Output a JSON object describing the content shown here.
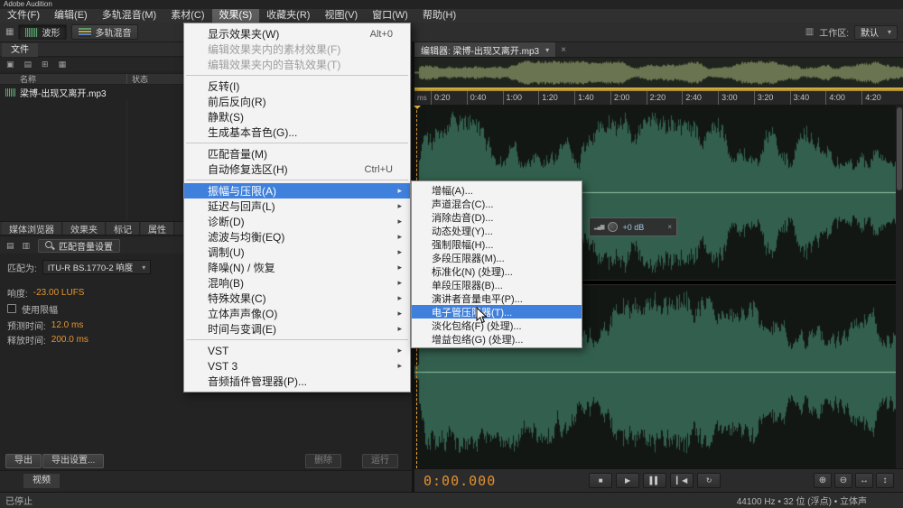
{
  "app": {
    "title": "Adobe Audition"
  },
  "menubar": [
    {
      "label": "文件(F)",
      "name": "menu-file"
    },
    {
      "label": "编辑(E)",
      "name": "menu-edit"
    },
    {
      "label": "多轨混音(M)",
      "name": "menu-multitrack"
    },
    {
      "label": "素材(C)",
      "name": "menu-clip"
    },
    {
      "label": "效果(S)",
      "name": "menu-effects",
      "active": true
    },
    {
      "label": "收藏夹(R)",
      "name": "menu-favorites"
    },
    {
      "label": "视图(V)",
      "name": "menu-view"
    },
    {
      "label": "窗口(W)",
      "name": "menu-window"
    },
    {
      "label": "帮助(H)",
      "name": "menu-help"
    }
  ],
  "toolbar": {
    "waveform_btn": "波形",
    "multitrack_btn": "多轨混音",
    "workspace_label": "工作区:",
    "workspace_value": "默认"
  },
  "files_panel": {
    "tab": "文件",
    "name_col": "名称",
    "status_col": "状态",
    "file_name": "梁博-出现又离开.mp3"
  },
  "effects_menu": {
    "items": [
      {
        "label": "显示效果夹(W)",
        "shortcut": "Alt+0"
      },
      {
        "label": "编辑效果夹内的素材效果(F)",
        "disabled": true
      },
      {
        "label": "编辑效果夹内的音轨效果(T)",
        "disabled": true
      },
      {
        "sep": true
      },
      {
        "label": "反转(I)"
      },
      {
        "label": "前后反向(R)"
      },
      {
        "label": "静默(S)"
      },
      {
        "label": "生成基本音色(G)..."
      },
      {
        "sep": true
      },
      {
        "label": "匹配音量(M)"
      },
      {
        "label": "自动修复选区(H)",
        "shortcut": "Ctrl+U"
      },
      {
        "sep": true
      },
      {
        "label": "振幅与压限(A)",
        "sub": true,
        "hl": true
      },
      {
        "label": "延迟与回声(L)",
        "sub": true
      },
      {
        "label": "诊断(D)",
        "sub": true
      },
      {
        "label": "滤波与均衡(EQ)",
        "sub": true
      },
      {
        "label": "调制(U)",
        "sub": true
      },
      {
        "label": "降噪(N) / 恢复",
        "sub": true
      },
      {
        "label": "混响(B)",
        "sub": true
      },
      {
        "label": "特殊效果(C)",
        "sub": true
      },
      {
        "label": "立体声声像(O)",
        "sub": true
      },
      {
        "label": "时间与变调(E)",
        "sub": true
      },
      {
        "sep": true
      },
      {
        "label": "VST",
        "sub": true
      },
      {
        "label": "VST 3",
        "sub": true
      },
      {
        "label": "音频插件管理器(P)..."
      }
    ]
  },
  "amplitude_submenu": {
    "items": [
      {
        "label": "增幅(A)..."
      },
      {
        "label": "声道混合(C)..."
      },
      {
        "label": "消除齿音(D)..."
      },
      {
        "label": "动态处理(Y)..."
      },
      {
        "label": "强制限幅(H)..."
      },
      {
        "label": "多段压限器(M)..."
      },
      {
        "label": "标准化(N) (处理)..."
      },
      {
        "label": "单段压限器(B)..."
      },
      {
        "label": "演讲者音量电平(P)..."
      },
      {
        "label": "电子管压限器(T)...",
        "hl": true
      },
      {
        "label": "淡化包络(F) (处理)..."
      },
      {
        "label": "增益包络(G) (处理)..."
      }
    ]
  },
  "left_tabs": [
    {
      "label": "媒体浏览器",
      "name": "tab-media-browser"
    },
    {
      "label": "效果夹",
      "name": "tab-effects-rack"
    },
    {
      "label": "标记",
      "name": "tab-markers"
    },
    {
      "label": "属性",
      "name": "tab-properties"
    }
  ],
  "match_volume": {
    "settings_btn": "匹配音量设置",
    "match_to_label": "匹配为:",
    "match_to_value": "ITU-R BS.1770-2 响度",
    "loudness_label": "响度:",
    "loudness_value": "-23.00 LUFS",
    "limiter_label": "使用限幅",
    "lookahead_label": "预测时间:",
    "lookahead_value": "12.0 ms",
    "release_label": "释放时间:",
    "release_value": "200.0 ms",
    "export_btn": "导出",
    "export_settings_btn": "导出设置...",
    "delete_btn": "删除",
    "run_btn": "运行"
  },
  "video_panel": {
    "tab": "视频"
  },
  "editor": {
    "tab": "编辑器: 梁博-出现又离开.mp3",
    "ruler_unit": "ms",
    "ruler_labels": [
      "0:20",
      "0:40",
      "1:00",
      "1:20",
      "1:40",
      "2:00",
      "2:20",
      "2:40",
      "3:00",
      "3:20",
      "3:40",
      "4:00",
      "4:20"
    ],
    "hud_value": "+0 dB",
    "time_display": "0:00.000"
  },
  "transport": {
    "buttons": [
      {
        "name": "stop-button",
        "glyph": "■"
      },
      {
        "name": "play-button",
        "glyph": "▶"
      },
      {
        "name": "pause-button",
        "glyph": "▌▌"
      },
      {
        "name": "skip-to-start-button",
        "glyph": "▎◀"
      },
      {
        "name": "loop-button",
        "glyph": "↻"
      }
    ],
    "zoom_buttons": [
      {
        "name": "zoom-in-button",
        "glyph": "⊕"
      },
      {
        "name": "zoom-out-button",
        "glyph": "⊖"
      },
      {
        "name": "zoom-horizontal-button",
        "glyph": "↔"
      },
      {
        "name": "zoom-vertical-button",
        "glyph": "↕"
      }
    ]
  },
  "status_bar": {
    "left": "已停止",
    "right": "44100 Hz • 32 位 (浮点) • 立体声"
  }
}
